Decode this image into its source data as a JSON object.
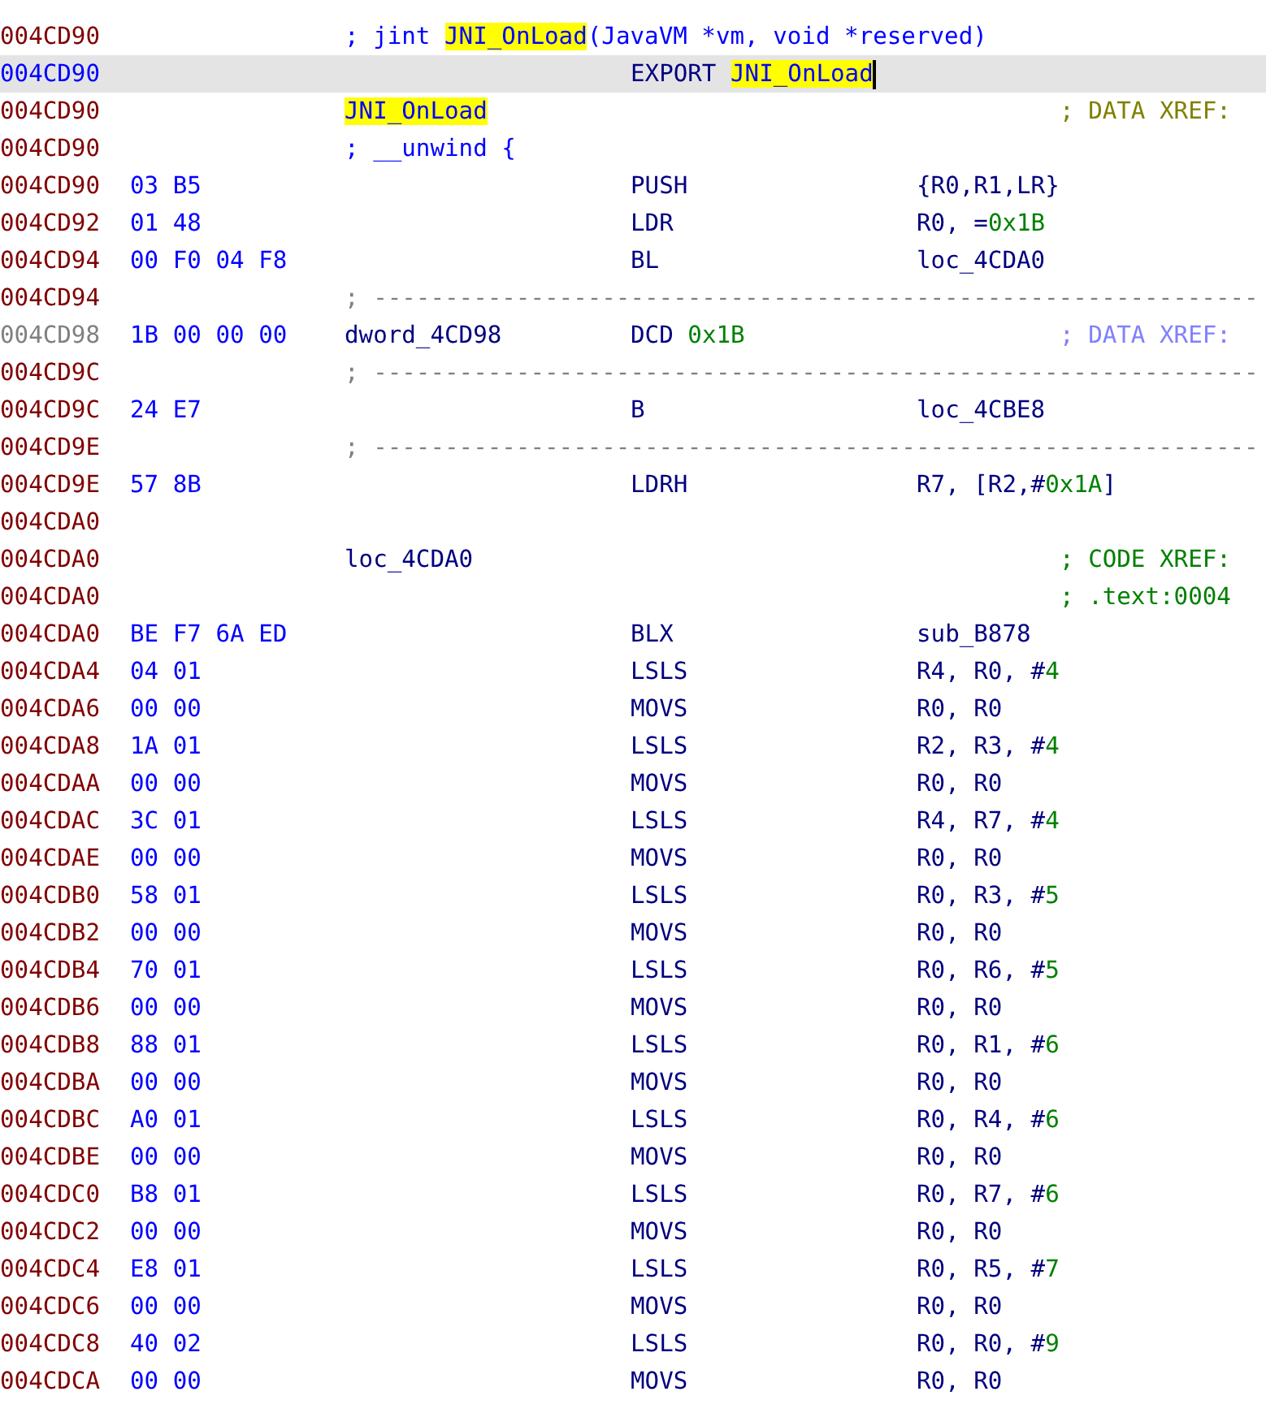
{
  "listing": {
    "rows": [
      {
        "kind": "comment",
        "address": "004CD90",
        "dim": false,
        "selected": false,
        "label": [
          {
            "text": "; jint ",
            "kind": "plain"
          },
          {
            "text": "JNI_OnLoad",
            "kind": "hl"
          },
          {
            "text": "(JavaVM *vm, void *reserved)",
            "kind": "plain"
          }
        ]
      },
      {
        "kind": "code",
        "address": "004CD90",
        "dim": false,
        "selected": true,
        "mnemonic": [
          {
            "text": "EXPORT ",
            "kind": "plain"
          },
          {
            "text": "JNI_OnLoad",
            "kind": "hl"
          }
        ]
      },
      {
        "kind": "code",
        "address": "004CD90",
        "dim": false,
        "selected": false,
        "label": [
          {
            "text": "JNI_OnLoad",
            "kind": "hl"
          }
        ],
        "comment": {
          "text": "; DATA XREF:",
          "color": "#808000"
        }
      },
      {
        "kind": "comment",
        "address": "004CD90",
        "dim": false,
        "selected": false,
        "label": [
          {
            "text": "; __unwind {",
            "kind": "plain"
          }
        ]
      },
      {
        "kind": "code",
        "address": "004CD90",
        "dim": false,
        "selected": false,
        "bytes": "03 B5",
        "mnemonic": [
          {
            "text": "PUSH",
            "kind": "plain"
          }
        ],
        "operands": [
          {
            "text": "{R0,R1,LR}",
            "kind": "plain"
          }
        ]
      },
      {
        "kind": "code",
        "address": "004CD92",
        "dim": false,
        "selected": false,
        "bytes": "01 48",
        "mnemonic": [
          {
            "text": "LDR",
            "kind": "plain"
          }
        ],
        "operands": [
          {
            "text": "R0, =",
            "kind": "plain"
          },
          {
            "text": "0x1B",
            "kind": "num"
          }
        ]
      },
      {
        "kind": "code",
        "address": "004CD94",
        "dim": false,
        "selected": false,
        "bytes": "00 F0 04 F8",
        "mnemonic": [
          {
            "text": "BL",
            "kind": "plain"
          }
        ],
        "operands": [
          {
            "text": "loc_4CDA0",
            "kind": "plain"
          }
        ]
      },
      {
        "kind": "separator",
        "address": "004CD94",
        "dim": false,
        "selected": false,
        "separator": "; --------------------------------------------------------------"
      },
      {
        "kind": "code",
        "address": "004CD98",
        "dim": true,
        "selected": false,
        "bytes": "1B 00 00 00",
        "label": [
          {
            "text": "dword_4CD98",
            "kind": "plain"
          }
        ],
        "mnemonic": [
          {
            "text": "DCD ",
            "kind": "plain"
          },
          {
            "text": "0x1B",
            "kind": "num"
          }
        ],
        "comment": {
          "text": "; DATA XREF:",
          "color": "#8080ff"
        }
      },
      {
        "kind": "separator",
        "address": "004CD9C",
        "dim": false,
        "selected": false,
        "separator": "; --------------------------------------------------------------"
      },
      {
        "kind": "code",
        "address": "004CD9C",
        "dim": false,
        "selected": false,
        "bytes": "24 E7",
        "mnemonic": [
          {
            "text": "B",
            "kind": "plain"
          }
        ],
        "operands": [
          {
            "text": "loc_4CBE8",
            "kind": "plain"
          }
        ]
      },
      {
        "kind": "separator",
        "address": "004CD9E",
        "dim": false,
        "selected": false,
        "separator": "; --------------------------------------------------------------"
      },
      {
        "kind": "code",
        "address": "004CD9E",
        "dim": false,
        "selected": false,
        "bytes": "57 8B",
        "mnemonic": [
          {
            "text": "LDRH",
            "kind": "plain"
          }
        ],
        "operands": [
          {
            "text": "R7, [R2,#",
            "kind": "plain"
          },
          {
            "text": "0x1A",
            "kind": "num"
          },
          {
            "text": "]",
            "kind": "plain"
          }
        ]
      },
      {
        "kind": "code",
        "address": "004CDA0",
        "dim": false,
        "selected": false
      },
      {
        "kind": "code",
        "address": "004CDA0",
        "dim": false,
        "selected": false,
        "label": [
          {
            "text": "loc_4CDA0",
            "kind": "plain"
          }
        ],
        "comment": {
          "text": "; CODE XREF:",
          "color": "#008000"
        }
      },
      {
        "kind": "code",
        "address": "004CDA0",
        "dim": false,
        "selected": false,
        "comment": {
          "text": "; .text:0004",
          "color": "#008000"
        }
      },
      {
        "kind": "code",
        "address": "004CDA0",
        "dim": false,
        "selected": false,
        "bytes": "BE F7 6A ED",
        "mnemonic": [
          {
            "text": "BLX",
            "kind": "plain"
          }
        ],
        "operands": [
          {
            "text": "sub_B878",
            "kind": "plain"
          }
        ]
      },
      {
        "kind": "code",
        "address": "004CDA4",
        "dim": false,
        "selected": false,
        "bytes": "04 01",
        "mnemonic": [
          {
            "text": "LSLS",
            "kind": "plain"
          }
        ],
        "operands": [
          {
            "text": "R4, R0, #",
            "kind": "plain"
          },
          {
            "text": "4",
            "kind": "num"
          }
        ]
      },
      {
        "kind": "code",
        "address": "004CDA6",
        "dim": false,
        "selected": false,
        "bytes": "00 00",
        "mnemonic": [
          {
            "text": "MOVS",
            "kind": "plain"
          }
        ],
        "operands": [
          {
            "text": "R0, R0",
            "kind": "plain"
          }
        ]
      },
      {
        "kind": "code",
        "address": "004CDA8",
        "dim": false,
        "selected": false,
        "bytes": "1A 01",
        "mnemonic": [
          {
            "text": "LSLS",
            "kind": "plain"
          }
        ],
        "operands": [
          {
            "text": "R2, R3, #",
            "kind": "plain"
          },
          {
            "text": "4",
            "kind": "num"
          }
        ]
      },
      {
        "kind": "code",
        "address": "004CDAA",
        "dim": false,
        "selected": false,
        "bytes": "00 00",
        "mnemonic": [
          {
            "text": "MOVS",
            "kind": "plain"
          }
        ],
        "operands": [
          {
            "text": "R0, R0",
            "kind": "plain"
          }
        ]
      },
      {
        "kind": "code",
        "address": "004CDAC",
        "dim": false,
        "selected": false,
        "bytes": "3C 01",
        "mnemonic": [
          {
            "text": "LSLS",
            "kind": "plain"
          }
        ],
        "operands": [
          {
            "text": "R4, R7, #",
            "kind": "plain"
          },
          {
            "text": "4",
            "kind": "num"
          }
        ]
      },
      {
        "kind": "code",
        "address": "004CDAE",
        "dim": false,
        "selected": false,
        "bytes": "00 00",
        "mnemonic": [
          {
            "text": "MOVS",
            "kind": "plain"
          }
        ],
        "operands": [
          {
            "text": "R0, R0",
            "kind": "plain"
          }
        ]
      },
      {
        "kind": "code",
        "address": "004CDB0",
        "dim": false,
        "selected": false,
        "bytes": "58 01",
        "mnemonic": [
          {
            "text": "LSLS",
            "kind": "plain"
          }
        ],
        "operands": [
          {
            "text": "R0, R3, #",
            "kind": "plain"
          },
          {
            "text": "5",
            "kind": "num"
          }
        ]
      },
      {
        "kind": "code",
        "address": "004CDB2",
        "dim": false,
        "selected": false,
        "bytes": "00 00",
        "mnemonic": [
          {
            "text": "MOVS",
            "kind": "plain"
          }
        ],
        "operands": [
          {
            "text": "R0, R0",
            "kind": "plain"
          }
        ]
      },
      {
        "kind": "code",
        "address": "004CDB4",
        "dim": false,
        "selected": false,
        "bytes": "70 01",
        "mnemonic": [
          {
            "text": "LSLS",
            "kind": "plain"
          }
        ],
        "operands": [
          {
            "text": "R0, R6, #",
            "kind": "plain"
          },
          {
            "text": "5",
            "kind": "num"
          }
        ]
      },
      {
        "kind": "code",
        "address": "004CDB6",
        "dim": false,
        "selected": false,
        "bytes": "00 00",
        "mnemonic": [
          {
            "text": "MOVS",
            "kind": "plain"
          }
        ],
        "operands": [
          {
            "text": "R0, R0",
            "kind": "plain"
          }
        ]
      },
      {
        "kind": "code",
        "address": "004CDB8",
        "dim": false,
        "selected": false,
        "bytes": "88 01",
        "mnemonic": [
          {
            "text": "LSLS",
            "kind": "plain"
          }
        ],
        "operands": [
          {
            "text": "R0, R1, #",
            "kind": "plain"
          },
          {
            "text": "6",
            "kind": "num"
          }
        ]
      },
      {
        "kind": "code",
        "address": "004CDBA",
        "dim": false,
        "selected": false,
        "bytes": "00 00",
        "mnemonic": [
          {
            "text": "MOVS",
            "kind": "plain"
          }
        ],
        "operands": [
          {
            "text": "R0, R0",
            "kind": "plain"
          }
        ]
      },
      {
        "kind": "code",
        "address": "004CDBC",
        "dim": false,
        "selected": false,
        "bytes": "A0 01",
        "mnemonic": [
          {
            "text": "LSLS",
            "kind": "plain"
          }
        ],
        "operands": [
          {
            "text": "R0, R4, #",
            "kind": "plain"
          },
          {
            "text": "6",
            "kind": "num"
          }
        ]
      },
      {
        "kind": "code",
        "address": "004CDBE",
        "dim": false,
        "selected": false,
        "bytes": "00 00",
        "mnemonic": [
          {
            "text": "MOVS",
            "kind": "plain"
          }
        ],
        "operands": [
          {
            "text": "R0, R0",
            "kind": "plain"
          }
        ]
      },
      {
        "kind": "code",
        "address": "004CDC0",
        "dim": false,
        "selected": false,
        "bytes": "B8 01",
        "mnemonic": [
          {
            "text": "LSLS",
            "kind": "plain"
          }
        ],
        "operands": [
          {
            "text": "R0, R7, #",
            "kind": "plain"
          },
          {
            "text": "6",
            "kind": "num"
          }
        ]
      },
      {
        "kind": "code",
        "address": "004CDC2",
        "dim": false,
        "selected": false,
        "bytes": "00 00",
        "mnemonic": [
          {
            "text": "MOVS",
            "kind": "plain"
          }
        ],
        "operands": [
          {
            "text": "R0, R0",
            "kind": "plain"
          }
        ]
      },
      {
        "kind": "code",
        "address": "004CDC4",
        "dim": false,
        "selected": false,
        "bytes": "E8 01",
        "mnemonic": [
          {
            "text": "LSLS",
            "kind": "plain"
          }
        ],
        "operands": [
          {
            "text": "R0, R5, #",
            "kind": "plain"
          },
          {
            "text": "7",
            "kind": "num"
          }
        ]
      },
      {
        "kind": "code",
        "address": "004CDC6",
        "dim": false,
        "selected": false,
        "bytes": "00 00",
        "mnemonic": [
          {
            "text": "MOVS",
            "kind": "plain"
          }
        ],
        "operands": [
          {
            "text": "R0, R0",
            "kind": "plain"
          }
        ]
      },
      {
        "kind": "code",
        "address": "004CDC8",
        "dim": false,
        "selected": false,
        "bytes": "40 02",
        "mnemonic": [
          {
            "text": "LSLS",
            "kind": "plain"
          }
        ],
        "operands": [
          {
            "text": "R0, R0, #",
            "kind": "plain"
          },
          {
            "text": "9",
            "kind": "num"
          }
        ]
      },
      {
        "kind": "code",
        "address": "004CDCA",
        "dim": false,
        "selected": false,
        "bytes": "00 00",
        "mnemonic": [
          {
            "text": "MOVS",
            "kind": "plain"
          }
        ],
        "operands": [
          {
            "text": "R0, R0",
            "kind": "plain"
          }
        ]
      }
    ]
  }
}
